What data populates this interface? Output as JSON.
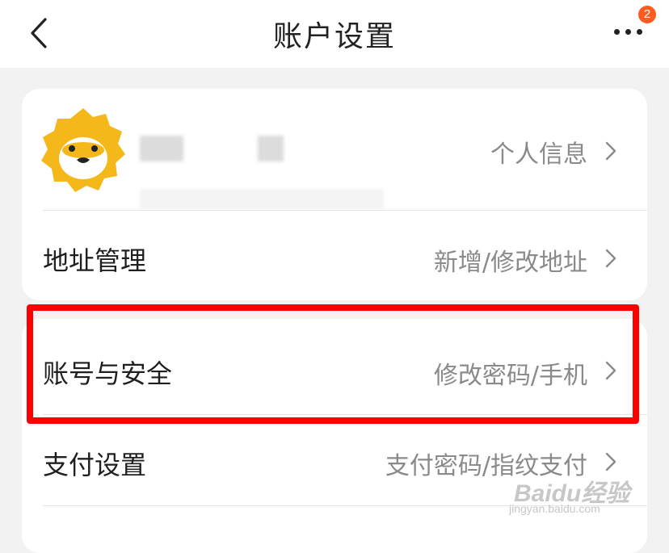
{
  "header": {
    "title": "账户设置",
    "back_icon": "chevron-left-icon",
    "more_icon": "more-dots-icon",
    "notification_count": "2"
  },
  "profile": {
    "link_label": "个人信息",
    "avatar": "lion-avatar-icon"
  },
  "address": {
    "label": "地址管理",
    "value": "新增/修改地址"
  },
  "security": {
    "label": "账号与安全",
    "value": "修改密码/手机"
  },
  "payment": {
    "label": "支付设置",
    "value": "支付密码/指纹支付"
  },
  "watermark": {
    "logo": "Baidu经验",
    "url": "jingyan.baidu.com"
  },
  "colors": {
    "highlight": "#ff0000",
    "badge": "#ff5a1f",
    "avatar": "#f5b81b"
  }
}
